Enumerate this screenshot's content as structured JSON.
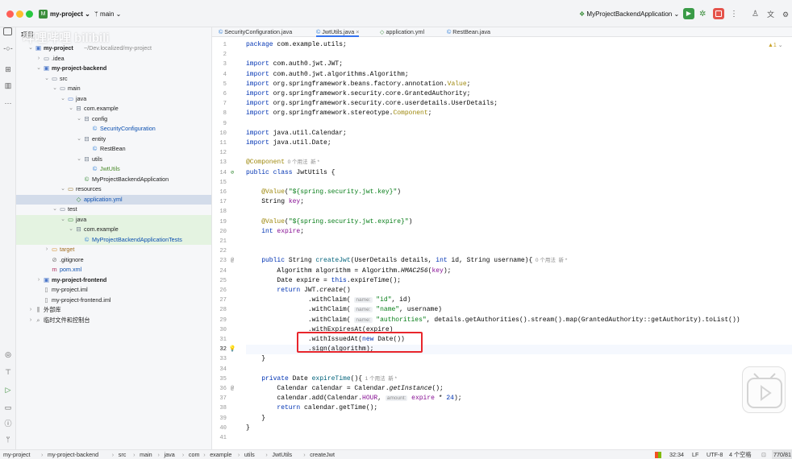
{
  "titlebar": {
    "project": "my-project",
    "branch": "main",
    "run_config": "MyProjectBackendApplication"
  },
  "project_panel": {
    "title": "项目",
    "tree": [
      {
        "label": "my-project",
        "suffix": "~/Dev.localized/my-project",
        "icon": "module-icon",
        "level": 0,
        "chev": "v",
        "bold": true
      },
      {
        "label": ".idea",
        "icon": "folder-icon",
        "level": 1,
        "chev": ">"
      },
      {
        "label": "my-project-backend",
        "icon": "module-icon",
        "level": 1,
        "chev": "v",
        "bold": true
      },
      {
        "label": "src",
        "icon": "folder-icon",
        "level": 2,
        "chev": "v"
      },
      {
        "label": "main",
        "icon": "folder-icon",
        "level": 3,
        "chev": "v"
      },
      {
        "label": "java",
        "icon": "source-folder-icon",
        "level": 4,
        "chev": "v"
      },
      {
        "label": "com.example",
        "icon": "package-icon",
        "level": 5,
        "chev": "v"
      },
      {
        "label": "config",
        "icon": "package-icon",
        "level": 6,
        "chev": "v"
      },
      {
        "label": "SecurityConfiguration",
        "icon": "class-icon",
        "level": 7,
        "chev": "",
        "color": "#0b4fb0"
      },
      {
        "label": "entity",
        "icon": "package-icon",
        "level": 6,
        "chev": "v"
      },
      {
        "label": "RestBean",
        "icon": "class-icon",
        "level": 7,
        "chev": ""
      },
      {
        "label": "utils",
        "icon": "package-icon",
        "level": 6,
        "chev": "v"
      },
      {
        "label": "JwtUtils",
        "icon": "class-icon",
        "level": 7,
        "chev": "",
        "color": "#4a8a2a"
      },
      {
        "label": "MyProjectBackendApplication",
        "icon": "spring-class-icon",
        "level": 6,
        "chev": ""
      },
      {
        "label": "resources",
        "icon": "resources-folder-icon",
        "level": 4,
        "chev": "v"
      },
      {
        "label": "application.yml",
        "icon": "yml-file-icon",
        "level": 5,
        "chev": "",
        "selected": true,
        "color": "#0b4fb0"
      },
      {
        "label": "test",
        "icon": "folder-icon",
        "level": 3,
        "chev": "v"
      },
      {
        "label": "java",
        "icon": "test-folder-icon",
        "level": 4,
        "chev": "v",
        "test": true
      },
      {
        "label": "com.example",
        "icon": "package-icon",
        "level": 5,
        "chev": "v",
        "test": true
      },
      {
        "label": "MyProjectBackendApplicationTests",
        "icon": "class-icon",
        "level": 6,
        "chev": "",
        "test": true,
        "color": "#0b4fb0"
      },
      {
        "label": "target",
        "icon": "excluded-folder-icon",
        "level": 2,
        "chev": ">",
        "color": "#a06a1a"
      },
      {
        "label": ".gitignore",
        "icon": "ignore-file-icon",
        "level": 2,
        "chev": ""
      },
      {
        "label": "pom.xml",
        "icon": "maven-icon",
        "level": 2,
        "chev": "",
        "color": "#0b4fb0"
      },
      {
        "label": "my-project-frontend",
        "icon": "module-icon",
        "level": 1,
        "chev": ">",
        "bold": true
      },
      {
        "label": "my-project.iml",
        "icon": "iml-file-icon",
        "level": 1,
        "chev": ""
      },
      {
        "label": "my-project-frontend.iml",
        "icon": "iml-file-icon",
        "level": 1,
        "chev": ""
      },
      {
        "label": "外部库",
        "icon": "library-icon",
        "level": 0,
        "chev": ">"
      },
      {
        "label": "临时文件和控制台",
        "icon": "scratch-icon",
        "level": 0,
        "chev": ">"
      }
    ]
  },
  "tabs": [
    {
      "label": "SecurityConfiguration.java",
      "icon": "class-icon",
      "active": false
    },
    {
      "label": "JwtUtils.java",
      "icon": "class-icon",
      "active": true,
      "close": "×"
    },
    {
      "label": "application.yml",
      "icon": "yml-file-icon",
      "active": false
    },
    {
      "label": "RestBean.java",
      "icon": "class-icon",
      "active": false
    }
  ],
  "editor": {
    "warnings": "▲1",
    "current_line": 32,
    "lines": [
      [
        [
          "kw",
          "package "
        ],
        [
          "",
          "com.example.utils;"
        ]
      ],
      [],
      [
        [
          "kw",
          "import "
        ],
        [
          "",
          "com.auth0.jwt.JWT;"
        ]
      ],
      [
        [
          "kw",
          "import "
        ],
        [
          "",
          "com.auth0.jwt.algorithms.Algorithm;"
        ]
      ],
      [
        [
          "kw",
          "import "
        ],
        [
          "",
          "org.springframework.beans.factory.annotation."
        ],
        [
          "an",
          "Value"
        ],
        [
          "",
          ";"
        ]
      ],
      [
        [
          "kw",
          "import "
        ],
        [
          "",
          "org.springframework.security.core.GrantedAuthority;"
        ]
      ],
      [
        [
          "kw",
          "import "
        ],
        [
          "",
          "org.springframework.security.core.userdetails.UserDetails;"
        ]
      ],
      [
        [
          "kw",
          "import "
        ],
        [
          "",
          "org.springframework.stereotype."
        ],
        [
          "an",
          "Component"
        ],
        [
          "",
          ";"
        ]
      ],
      [],
      [
        [
          "kw",
          "import "
        ],
        [
          "",
          "java.util.Calendar;"
        ]
      ],
      [
        [
          "kw",
          "import "
        ],
        [
          "",
          "java.util.Date;"
        ]
      ],
      [],
      [
        [
          "an",
          "@Component"
        ],
        [
          "usage",
          "  0 个用法  新 *"
        ]
      ],
      [
        [
          "kw",
          "public class "
        ],
        [
          "",
          "JwtUtils {"
        ]
      ],
      [],
      [
        [
          "",
          "    "
        ],
        [
          "an",
          "@Value"
        ],
        [
          "",
          "("
        ],
        [
          "st",
          "\"${spring.security.jwt.key}\""
        ],
        [
          "",
          ")"
        ]
      ],
      [
        [
          "",
          "    String "
        ],
        [
          "fd",
          "key"
        ],
        [
          "",
          ";"
        ]
      ],
      [],
      [
        [
          "",
          "    "
        ],
        [
          "an",
          "@Value"
        ],
        [
          "",
          "("
        ],
        [
          "st",
          "\"${spring.security.jwt.expire}\""
        ],
        [
          "",
          ")"
        ]
      ],
      [
        [
          "",
          "    "
        ],
        [
          "kw",
          "int "
        ],
        [
          "fd",
          "expire"
        ],
        [
          "",
          ";"
        ]
      ],
      [],
      [],
      [
        [
          "",
          "    "
        ],
        [
          "kw",
          "public "
        ],
        [
          "",
          "String "
        ],
        [
          "fn",
          "createJwt"
        ],
        [
          "",
          "(UserDetails details, "
        ],
        [
          "kw",
          "int "
        ],
        [
          "",
          "id, String username){"
        ],
        [
          "usage",
          "  0 个用法  新 *"
        ]
      ],
      [
        [
          "",
          "        Algorithm algorithm = Algorithm."
        ],
        [
          "it",
          "HMAC256"
        ],
        [
          "",
          "("
        ],
        [
          "fd",
          "key"
        ],
        [
          "",
          ");"
        ]
      ],
      [
        [
          "",
          "        Date expire = "
        ],
        [
          "kw",
          "this"
        ],
        [
          "",
          ".expireTime();"
        ]
      ],
      [
        [
          "",
          "        "
        ],
        [
          "kw",
          "return "
        ],
        [
          "",
          "JWT."
        ],
        [
          "it",
          "create"
        ],
        [
          "",
          "()"
        ]
      ],
      [
        [
          "",
          "                .withClaim( "
        ],
        [
          "hint",
          "name:"
        ],
        [
          "",
          ""
        ],
        [
          "st",
          " \"id\""
        ],
        [
          "",
          ", id)"
        ]
      ],
      [
        [
          "",
          "                .withClaim( "
        ],
        [
          "hint",
          "name:"
        ],
        [
          "st",
          " \"name\""
        ],
        [
          "",
          ", username)"
        ]
      ],
      [
        [
          "",
          "                .withClaim( "
        ],
        [
          "hint",
          "name:"
        ],
        [
          "st",
          " \"authorities\""
        ],
        [
          "",
          ", details.getAuthorities().stream().map(GrantedAuthority::getAuthority).toList())"
        ]
      ],
      [
        [
          "",
          "                .withExpiresAt(expire)"
        ]
      ],
      [
        [
          "",
          "                .withIssuedAt("
        ],
        [
          "kw",
          "new "
        ],
        [
          "",
          "Date())"
        ]
      ],
      [
        [
          "",
          "                .sign(algorithm);"
        ]
      ],
      [
        [
          "",
          "    }"
        ]
      ],
      [],
      [
        [
          "",
          "    "
        ],
        [
          "kw",
          "private "
        ],
        [
          "",
          "Date "
        ],
        [
          "fn",
          "expireTime"
        ],
        [
          "",
          "(){"
        ],
        [
          "usage",
          "  1 个用法  新 *"
        ]
      ],
      [
        [
          "",
          "        Calendar calendar = Calendar."
        ],
        [
          "it",
          "getInstance"
        ],
        [
          "",
          "();"
        ]
      ],
      [
        [
          "",
          "        calendar.add(Calendar."
        ],
        [
          "fd",
          "HOUR"
        ],
        [
          "",
          ", "
        ],
        [
          "hint",
          "amount:"
        ],
        [
          "",
          ""
        ],
        [
          "fd",
          " expire"
        ],
        [
          "",
          " * "
        ],
        [
          "kw",
          "24"
        ],
        [
          "",
          ");"
        ]
      ],
      [
        [
          "",
          "        "
        ],
        [
          "kw",
          "return "
        ],
        [
          "",
          "calendar.getTime();"
        ]
      ],
      [
        [
          "",
          "    }"
        ]
      ],
      [
        [
          "",
          "}"
        ]
      ],
      []
    ]
  },
  "statusbar": {
    "breadcrumbs": [
      "my-project",
      "my-project-backend",
      "src",
      "main",
      "java",
      "com",
      "example",
      "utils",
      "JwtUtils",
      "createJwt"
    ],
    "position": "32:34",
    "line_ending": "LF",
    "encoding": "UTF-8",
    "indent": "4 个空格",
    "memory": "770/81"
  },
  "watermark": "哔哩哔哩 bilibili"
}
